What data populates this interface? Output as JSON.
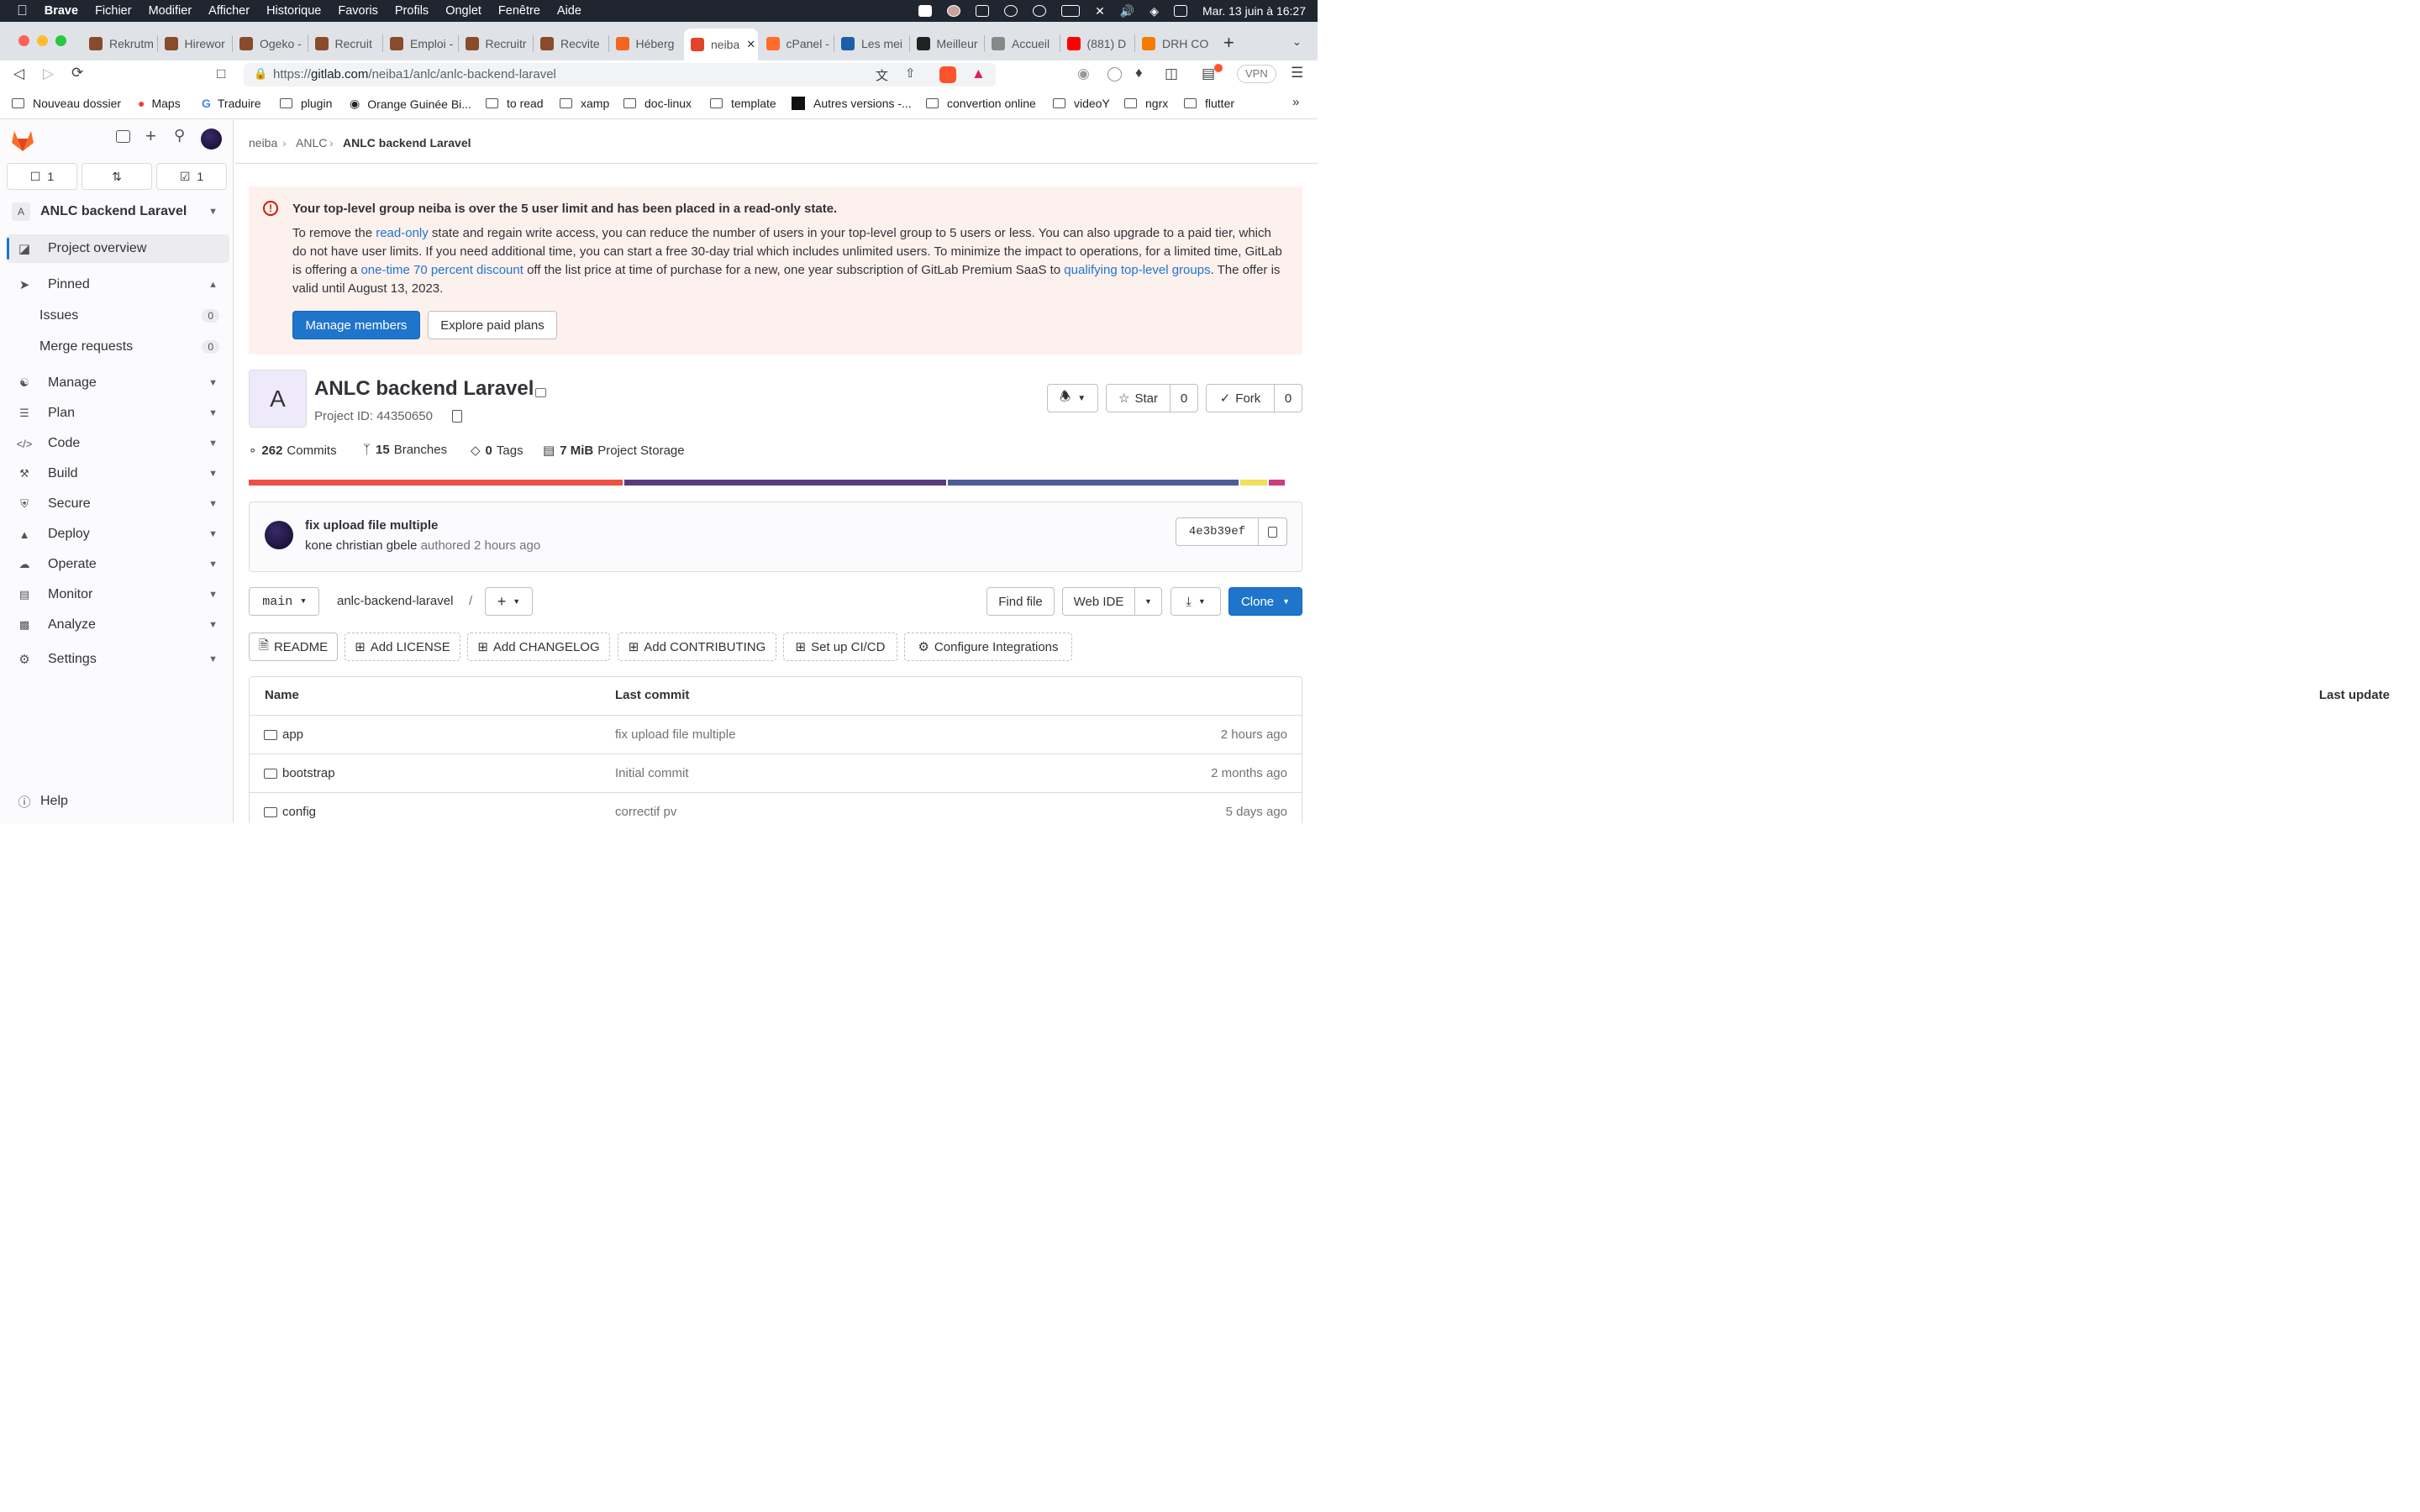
{
  "menubar": {
    "app": "Brave",
    "items": [
      "Fichier",
      "Modifier",
      "Afficher",
      "Historique",
      "Favoris",
      "Profils",
      "Onglet",
      "Fenêtre",
      "Aide"
    ],
    "clock": "Mar. 13 juin à 16:27"
  },
  "tabs": [
    {
      "label": "Rekrutm",
      "color": "#8a4b2a"
    },
    {
      "label": "Hirewor",
      "color": "#8a4b2a"
    },
    {
      "label": "Ogeko -",
      "color": "#8a4b2a"
    },
    {
      "label": "Recruit",
      "color": "#8a4b2a"
    },
    {
      "label": "Emploi -",
      "color": "#8a4b2a"
    },
    {
      "label": "Recruitr",
      "color": "#8a4b2a"
    },
    {
      "label": "Recvite",
      "color": "#8a4b2a"
    },
    {
      "label": "Héberg",
      "color": "#f26522"
    },
    {
      "label": "neiba",
      "color": "#e24329"
    },
    {
      "label": "cPanel -",
      "color": "#ff6c2c"
    },
    {
      "label": "Les mei",
      "color": "#1a5fa8"
    },
    {
      "label": "Meilleur",
      "color": "#222222"
    },
    {
      "label": "Accueil",
      "color": "#888888"
    },
    {
      "label": "(881) D",
      "color": "#ff0000"
    },
    {
      "label": "DRH CO",
      "color": "#f57c00"
    }
  ],
  "address": {
    "prefix": "https://",
    "host": "gitlab.com",
    "path": "/neiba1/anlc/anlc-backend-laravel",
    "vpn": "VPN"
  },
  "bookmarks": [
    "Nouveau dossier",
    "Maps",
    "Traduire",
    "plugin",
    "Orange Guinée Bi...",
    "to read",
    "xamp",
    "doc-linux",
    "template",
    "Autres versions -...",
    "convertion online",
    "videoY",
    "ngrx",
    "flutter"
  ],
  "sidebar": {
    "counts": {
      "issues": "1",
      "todos": "1"
    },
    "project_letter": "A",
    "project": "ANLC backend Laravel",
    "overview": "Project overview",
    "pinned": "Pinned",
    "issues": "Issues",
    "issues_count": "0",
    "mrs": "Merge requests",
    "mrs_count": "0",
    "sections": [
      "Manage",
      "Plan",
      "Code",
      "Build",
      "Secure",
      "Deploy",
      "Operate",
      "Monitor",
      "Analyze"
    ],
    "settings": "Settings",
    "help": "Help"
  },
  "breadcrumb": [
    "neiba",
    "ANLC",
    "ANLC backend Laravel"
  ],
  "alert": {
    "title": "Your top-level group neiba is over the 5 user limit and has been placed in a read-only state.",
    "p1": "To remove the ",
    "link1": "read-only",
    "p2": " state and regain write access, you can reduce the number of users in your top-level group to 5 users or less. You can also upgrade to a paid tier, which do not have user limits. If you need additional time, you can start a free 30-day trial which includes unlimited users. To minimize the impact to operations, for a limited time, GitLab is offering a ",
    "link2": "one-time 70 percent discount",
    "p3": " off the list price at time of purchase for a new, one year subscription of GitLab Premium SaaS to ",
    "link3": "qualifying top-level groups",
    "p4": ". The offer is valid until August 13, 2023.",
    "btn1": "Manage members",
    "btn2": "Explore paid plans"
  },
  "project": {
    "letter": "A",
    "name": "ANLC backend Laravel",
    "id": "Project ID: 44350650",
    "star": "Star",
    "star_count": "0",
    "fork": "Fork",
    "fork_count": "0",
    "commits_n": "262",
    "commits": "Commits",
    "branches_n": "15",
    "branches": "Branches",
    "tags_n": "0",
    "tags": "Tags",
    "storage_n": "7 MiB",
    "storage": "Project Storage"
  },
  "languages": [
    {
      "share": 0.36,
      "color": "#ed5043"
    },
    {
      "share": 0.31,
      "color": "#563d7c"
    },
    {
      "share": 0.28,
      "color": "#4f5d95"
    },
    {
      "share": 0.027,
      "color": "#f1e05a"
    },
    {
      "share": 0.017,
      "color": "#cc3e7f"
    }
  ],
  "commit": {
    "title": "fix upload file multiple",
    "author": "kone christian gbele",
    "authored": "authored",
    "when": "2 hours ago",
    "sha": "4e3b39ef"
  },
  "toolbar": {
    "branch": "main",
    "repo": "anlc-backend-laravel",
    "slash": "/",
    "find": "Find file",
    "webide": "Web IDE",
    "clone": "Clone"
  },
  "actions": [
    "README",
    "Add LICENSE",
    "Add CHANGELOG",
    "Add CONTRIBUTING",
    "Set up CI/CD",
    "Configure Integrations"
  ],
  "table": {
    "headers": [
      "Name",
      "Last commit",
      "Last update"
    ],
    "rows": [
      {
        "name": "app",
        "commit": "fix upload file multiple",
        "updated": "2 hours ago"
      },
      {
        "name": "bootstrap",
        "commit": "Initial commit",
        "updated": "2 months ago"
      },
      {
        "name": "config",
        "commit": "correctif pv",
        "updated": "5 days ago"
      }
    ]
  }
}
